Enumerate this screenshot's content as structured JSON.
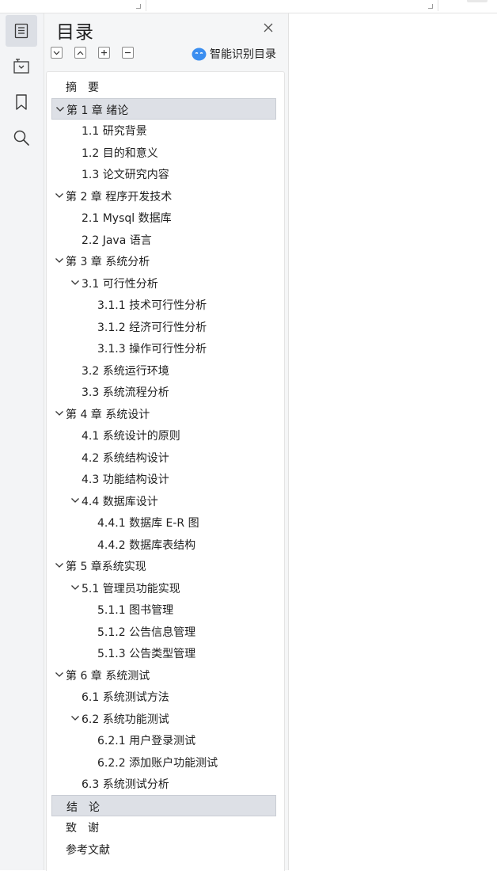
{
  "panel": {
    "title": "目录",
    "smart_toc_label": "智能识别目录"
  },
  "rail": {
    "items": [
      {
        "name": "toc-icon",
        "active": true
      },
      {
        "name": "navigation-pane-icon",
        "active": false
      },
      {
        "name": "bookmark-icon",
        "active": false
      },
      {
        "name": "search-icon",
        "active": false
      }
    ]
  },
  "toc": [
    {
      "label": "摘　要",
      "level": 0,
      "expandable": false,
      "highlighted": false
    },
    {
      "label": "第 1 章  绪论",
      "level": 0,
      "expandable": true,
      "highlighted": true
    },
    {
      "label": "1.1  研究背景",
      "level": 1,
      "expandable": false,
      "highlighted": false
    },
    {
      "label": "1.2 目的和意义",
      "level": 1,
      "expandable": false,
      "highlighted": false
    },
    {
      "label": "1.3  论文研究内容",
      "level": 1,
      "expandable": false,
      "highlighted": false
    },
    {
      "label": "第 2 章  程序开发技术",
      "level": 0,
      "expandable": true,
      "highlighted": false
    },
    {
      "label": "2.1 Mysql 数据库",
      "level": 1,
      "expandable": false,
      "highlighted": false
    },
    {
      "label": "2.2 Java 语言",
      "level": 1,
      "expandable": false,
      "highlighted": false
    },
    {
      "label": "第 3 章  系统分析",
      "level": 0,
      "expandable": true,
      "highlighted": false
    },
    {
      "label": "3.1 可行性分析",
      "level": 1,
      "expandable": true,
      "highlighted": false
    },
    {
      "label": "3.1.1 技术可行性分析",
      "level": 2,
      "expandable": false,
      "highlighted": false
    },
    {
      "label": "3.1.2 经济可行性分析",
      "level": 2,
      "expandable": false,
      "highlighted": false
    },
    {
      "label": "3.1.3 操作可行性分析",
      "level": 2,
      "expandable": false,
      "highlighted": false
    },
    {
      "label": "3.2 系统运行环境",
      "level": 1,
      "expandable": false,
      "highlighted": false
    },
    {
      "label": "3.3 系统流程分析",
      "level": 1,
      "expandable": false,
      "highlighted": false
    },
    {
      "label": "第 4 章  系统设计",
      "level": 0,
      "expandable": true,
      "highlighted": false
    },
    {
      "label": "4.1  系统设计的原则",
      "level": 1,
      "expandable": false,
      "highlighted": false
    },
    {
      "label": "4.2  系统结构设计",
      "level": 1,
      "expandable": false,
      "highlighted": false
    },
    {
      "label": "4.3 功能结构设计",
      "level": 1,
      "expandable": false,
      "highlighted": false
    },
    {
      "label": "4.4 数据库设计",
      "level": 1,
      "expandable": true,
      "highlighted": false
    },
    {
      "label": "4.4.1  数据库 E-R 图",
      "level": 2,
      "expandable": false,
      "highlighted": false
    },
    {
      "label": "4.4.2  数据库表结构",
      "level": 2,
      "expandable": false,
      "highlighted": false
    },
    {
      "label": "第 5 章系统实现",
      "level": 0,
      "expandable": true,
      "highlighted": false
    },
    {
      "label": "5.1 管理员功能实现",
      "level": 1,
      "expandable": true,
      "highlighted": false
    },
    {
      "label": "5.1.1  图书管理",
      "level": 2,
      "expandable": false,
      "highlighted": false
    },
    {
      "label": "5.1.2  公告信息管理",
      "level": 2,
      "expandable": false,
      "highlighted": false
    },
    {
      "label": "5.1.3 公告类型管理",
      "level": 2,
      "expandable": false,
      "highlighted": false
    },
    {
      "label": "第 6 章  系统测试",
      "level": 0,
      "expandable": true,
      "highlighted": false
    },
    {
      "label": "6.1 系统测试方法",
      "level": 1,
      "expandable": false,
      "highlighted": false
    },
    {
      "label": "6.2  系统功能测试",
      "level": 1,
      "expandable": true,
      "highlighted": false
    },
    {
      "label": "6.2.1  用户登录测试",
      "level": 2,
      "expandable": false,
      "highlighted": false
    },
    {
      "label": "6.2.2  添加账户功能测试",
      "level": 2,
      "expandable": false,
      "highlighted": false
    },
    {
      "label": "6.3  系统测试分析",
      "level": 1,
      "expandable": false,
      "highlighted": false
    },
    {
      "label": "结　论",
      "level": 0,
      "expandable": false,
      "highlighted": true
    },
    {
      "label": "致　谢",
      "level": 0,
      "expandable": false,
      "highlighted": false
    },
    {
      "label": "参考文献",
      "level": 0,
      "expandable": false,
      "highlighted": false
    }
  ],
  "colors": {
    "accent": "#3b8ef0",
    "highlight": "#dde0e6",
    "panel_bg": "#f5f6f7",
    "rail_bg": "#f3f4f6"
  }
}
